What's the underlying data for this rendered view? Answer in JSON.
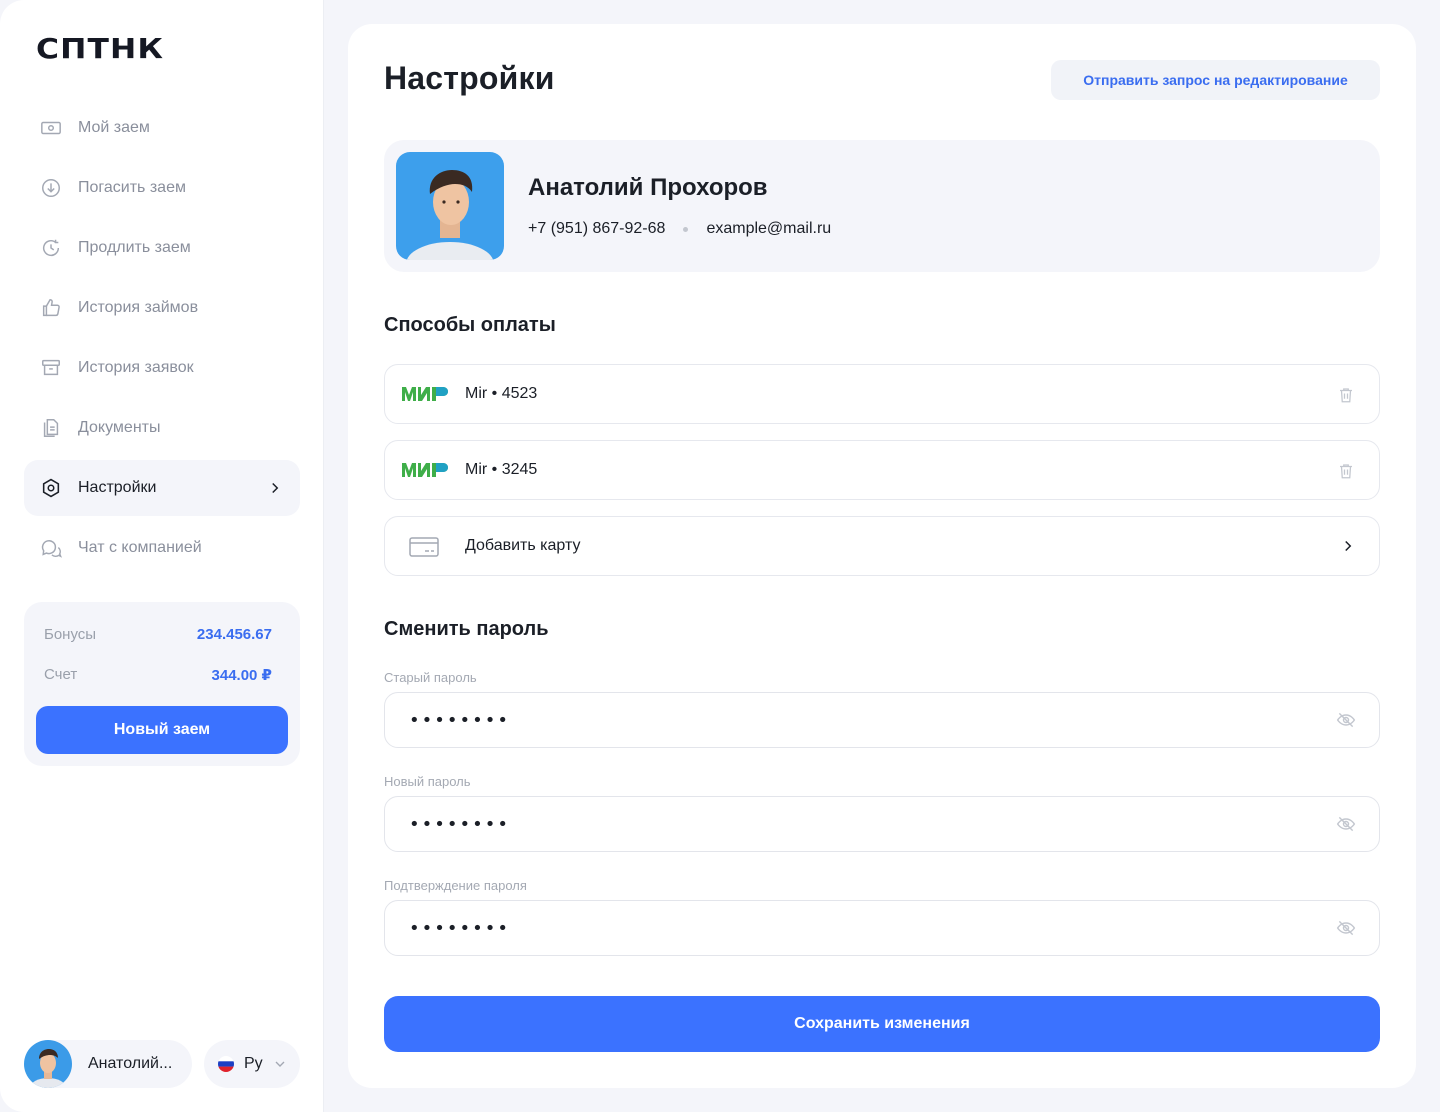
{
  "brand": {
    "logo": "СПТНК"
  },
  "sidebar": {
    "items": [
      {
        "label": "Мой заем",
        "icon": "banknote-icon"
      },
      {
        "label": "Погасить заем",
        "icon": "arrow-down-circle-icon"
      },
      {
        "label": "Продлить заем",
        "icon": "refresh-clock-icon"
      },
      {
        "label": "История займов",
        "icon": "thumbs-up-icon"
      },
      {
        "label": "История заявок",
        "icon": "archive-box-icon"
      },
      {
        "label": "Документы",
        "icon": "documents-icon"
      },
      {
        "label": "Настройки",
        "icon": "settings-hexagon-icon",
        "active": true
      },
      {
        "label": "Чат с компанией",
        "icon": "chat-bubbles-icon"
      }
    ],
    "balance": {
      "bonus_label": "Бонусы",
      "bonus_value": "234.456.67",
      "account_label": "Счет",
      "account_value": "344.00 ₽",
      "new_loan_label": "Новый заем"
    },
    "user": {
      "name": "Анатолий..."
    },
    "language": {
      "label": "Ру"
    }
  },
  "main": {
    "title": "Настройки",
    "edit_request_label": "Отправить запрос на редактирование",
    "profile": {
      "name": "Анатолий Прохоров",
      "phone": "+7 (951) 867-92-68",
      "email": "example@mail.ru"
    },
    "payment": {
      "title": "Способы оплаты",
      "cards": [
        {
          "label": "Mir • 4523",
          "brand": "МИР"
        },
        {
          "label": "Mir • 3245",
          "brand": "МИР"
        }
      ],
      "add_card_label": "Добавить карту"
    },
    "password": {
      "title": "Сменить пароль",
      "old_label": "Старый пароль",
      "new_label": "Новый пароль",
      "confirm_label": "Подтверждение пароля",
      "old_value": "••••••••",
      "new_value": "••••••••",
      "confirm_value": "••••••••"
    },
    "save_label": "Сохранить изменения"
  },
  "colors": {
    "accent": "#3b72ff",
    "accent_text": "#3a6df0",
    "mir_green": "#3fae49",
    "mir_blue": "#1b9fd9",
    "background": "#f4f5fa"
  }
}
